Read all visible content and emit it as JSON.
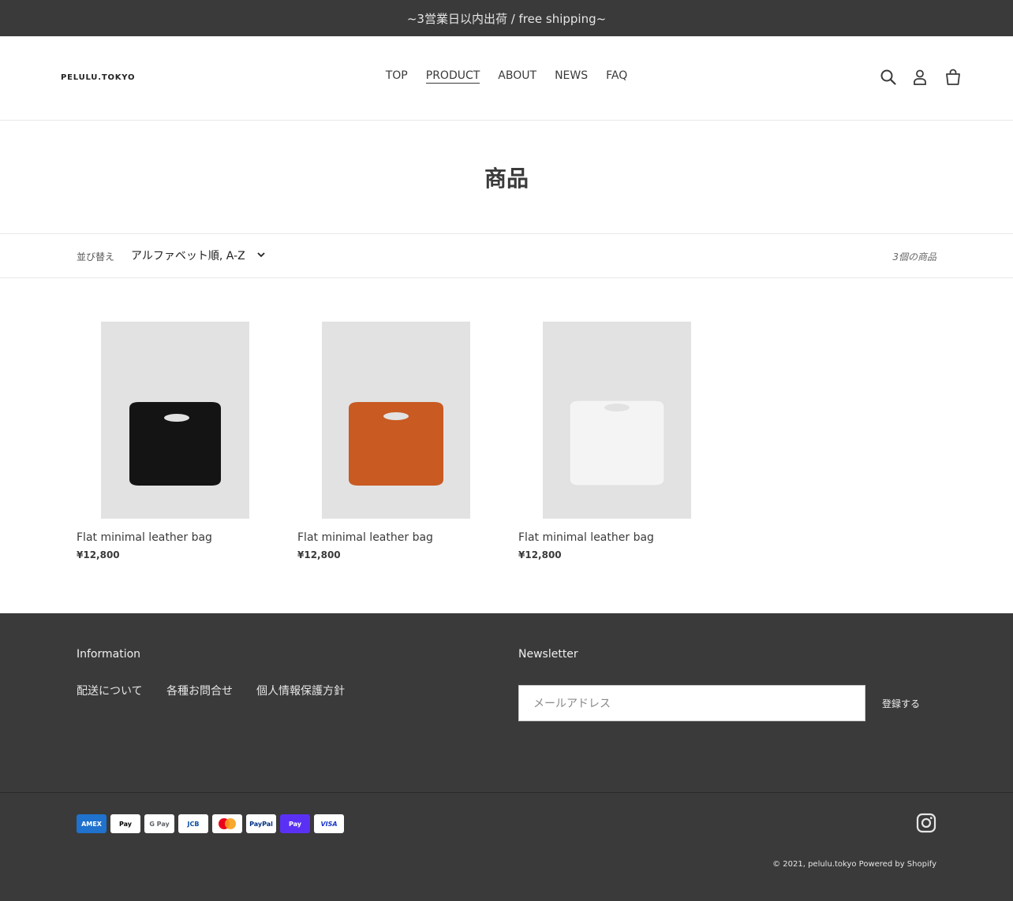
{
  "announcement": "~3営業日以内出荷 / free shipping~",
  "header": {
    "logo": "PELULU.TOKYO",
    "nav": [
      "TOP",
      "PRODUCT",
      "ABOUT",
      "NEWS",
      "FAQ"
    ],
    "active_nav": "PRODUCT",
    "icons": [
      "search-icon",
      "account-icon",
      "cart-icon"
    ]
  },
  "collection": {
    "title": "商品",
    "sort_label": "並び替え",
    "sort_value": "アルファベット順, A-Z",
    "count": "3個の商品"
  },
  "products": [
    {
      "name": "Flat minimal leather bag",
      "price": "¥12,800",
      "color": "#141414"
    },
    {
      "name": "Flat minimal leather bag",
      "price": "¥12,800",
      "color": "#c85a22"
    },
    {
      "name": "Flat minimal leather bag",
      "price": "¥12,800",
      "color": "#f4f4f4"
    }
  ],
  "footer": {
    "info_heading": "Information",
    "links": [
      "配送について",
      "各種お問合せ",
      "個人情報保護方針"
    ],
    "newsletter_heading": "Newsletter",
    "email_placeholder": "メールアドレス",
    "subscribe": "登録する",
    "payments": [
      "AMEX",
      "Pay",
      "G Pay",
      "JCB",
      "mastercard",
      "PayPal",
      "Pay",
      "VISA"
    ],
    "copyright": "© 2021, pelulu.tokyo Powered by Shopify"
  },
  "colors": {
    "dark": "#3a3a3a",
    "image_bg": "#e2e2e2"
  }
}
